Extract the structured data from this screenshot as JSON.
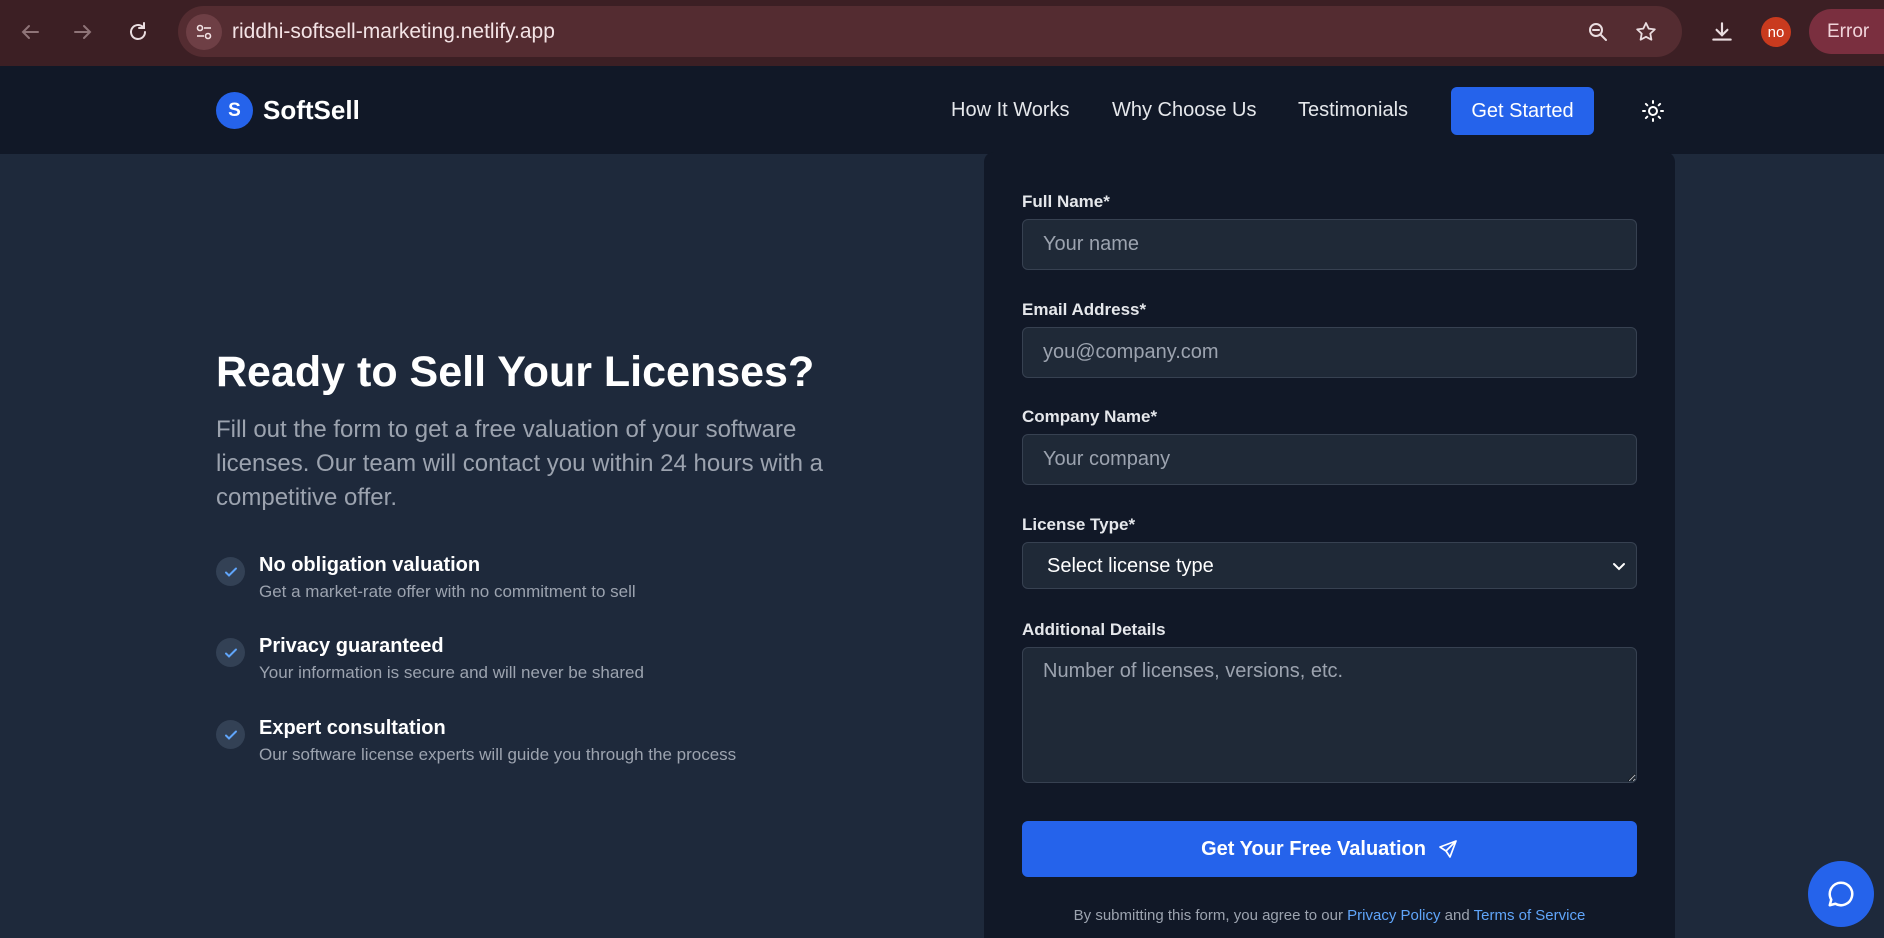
{
  "browser": {
    "url": "riddhi-softsell-marketing.netlify.app",
    "profile_initials": "no",
    "error_label": "Error"
  },
  "brand": {
    "logo_letter": "S",
    "name": "SoftSell",
    "accent": "#2563eb"
  },
  "nav": {
    "links": [
      "How It Works",
      "Why Choose Us",
      "Testimonials"
    ],
    "cta": "Get Started"
  },
  "hero": {
    "title": "Ready to Sell Your Licenses?",
    "subtitle": "Fill out the form to get a free valuation of your software licenses. Our team will contact you within 24 hours with a competitive offer.",
    "features": [
      {
        "title": "No obligation valuation",
        "desc": "Get a market-rate offer with no commitment to sell"
      },
      {
        "title": "Privacy guaranteed",
        "desc": "Your information is secure and will never be shared"
      },
      {
        "title": "Expert consultation",
        "desc": "Our software license experts will guide you through the process"
      }
    ]
  },
  "form": {
    "full_name_label": "Full Name*",
    "full_name_placeholder": "Your name",
    "email_label": "Email Address*",
    "email_placeholder": "you@company.com",
    "company_label": "Company Name*",
    "company_placeholder": "Your company",
    "license_label": "License Type*",
    "license_selected": "Select license type",
    "details_label": "Additional Details",
    "details_placeholder": "Number of licenses, versions, etc.",
    "submit": "Get Your Free Valuation",
    "legal_prefix": "By submitting this form, you agree to our",
    "privacy_link": "Privacy Policy",
    "legal_and": "and",
    "terms_link": "Terms of Service"
  }
}
